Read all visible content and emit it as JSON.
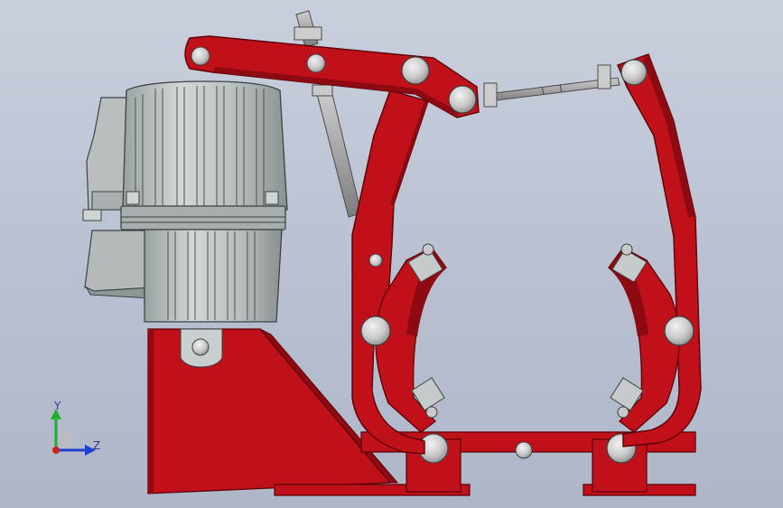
{
  "viewport": {
    "background_top": "#c9cfdc",
    "background_bottom": "#aeb6c8"
  },
  "model": {
    "part_color": "#c0101a",
    "part_shadow": "#8e0a12",
    "motor_color": "#bcc2c0",
    "motor_dark": "#8d9393",
    "pin_color": "#d6d6d6",
    "rod_color": "#a6a6a6"
  },
  "triad": {
    "y_label": "Y",
    "z_label": "Z",
    "y_color": "#1fae2e",
    "z_color": "#1f3fd0",
    "x_color": "#d01f1f"
  }
}
